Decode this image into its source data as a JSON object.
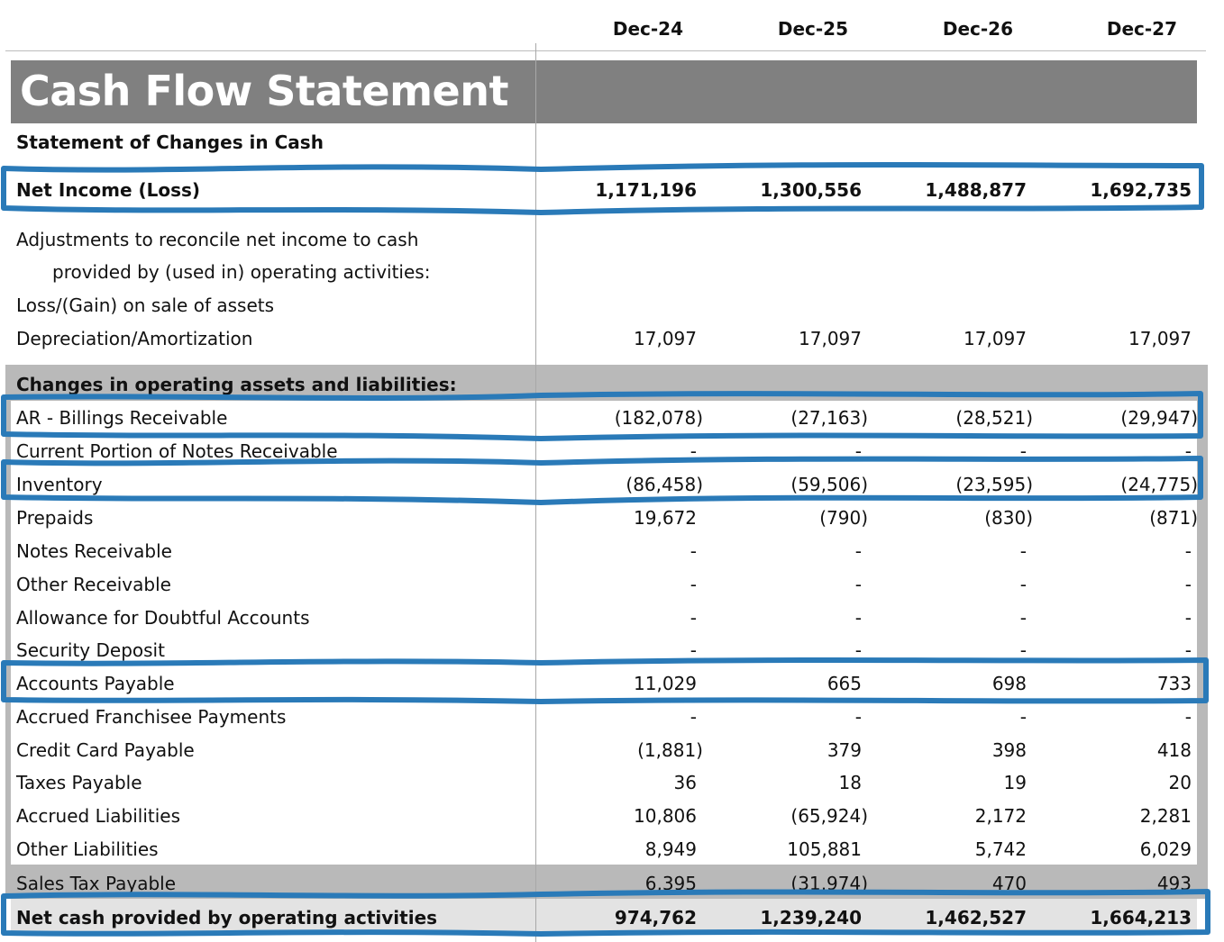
{
  "columns": [
    "Dec-24",
    "Dec-25",
    "Dec-26",
    "Dec-27"
  ],
  "title": "Cash Flow Statement",
  "subtitle": "Statement of Changes in Cash",
  "rows": [
    {
      "label": "Net Income (Loss)",
      "values": [
        "1,171,196",
        "1,300,556",
        "1,488,877",
        "1,692,735"
      ]
    },
    {
      "label": "Adjustments to reconcile net income to cash",
      "values": [
        "",
        "",
        "",
        ""
      ]
    },
    {
      "label": "provided by (used in) operating activities:",
      "values": [
        "",
        "",
        "",
        ""
      ]
    },
    {
      "label": "Loss/(Gain) on sale of assets",
      "values": [
        "",
        "",
        "",
        ""
      ]
    },
    {
      "label": "Depreciation/Amortization",
      "values": [
        "17,097",
        "17,097",
        "17,097",
        "17,097"
      ]
    },
    {
      "label": "Changes in operating assets and liabilities:",
      "values": [
        "",
        "",
        "",
        ""
      ]
    },
    {
      "label": "AR - Billings Receivable",
      "values": [
        "(182,078)",
        "(27,163)",
        "(28,521)",
        "(29,947)"
      ]
    },
    {
      "label": "Current Portion of Notes Receivable",
      "values": [
        "-",
        "-",
        "-",
        "-"
      ]
    },
    {
      "label": "Inventory",
      "values": [
        "(86,458)",
        "(59,506)",
        "(23,595)",
        "(24,775)"
      ]
    },
    {
      "label": "Prepaids",
      "values": [
        "19,672",
        "(790)",
        "(830)",
        "(871)"
      ]
    },
    {
      "label": "Notes Receivable",
      "values": [
        "-",
        "-",
        "-",
        "-"
      ]
    },
    {
      "label": "Other Receivable",
      "values": [
        "-",
        "-",
        "-",
        "-"
      ]
    },
    {
      "label": "Allowance for Doubtful Accounts",
      "values": [
        "-",
        "-",
        "-",
        "-"
      ]
    },
    {
      "label": "Security Deposit",
      "values": [
        "-",
        "-",
        "-",
        "-"
      ]
    },
    {
      "label": "Accounts Payable",
      "values": [
        "11,029",
        "665",
        "698",
        "733"
      ]
    },
    {
      "label": "Accrued Franchisee Payments",
      "values": [
        "-",
        "-",
        "-",
        "-"
      ]
    },
    {
      "label": "Credit Card Payable",
      "values": [
        "(1,881)",
        "379",
        "398",
        "418"
      ]
    },
    {
      "label": "Taxes Payable",
      "values": [
        "36",
        "18",
        "19",
        "20"
      ]
    },
    {
      "label": "Accrued Liabilities",
      "values": [
        "10,806",
        "(65,924)",
        "2,172",
        "2,281"
      ]
    },
    {
      "label": "Other Liabilities",
      "values": [
        "8,949",
        "105,881",
        "5,742",
        "6,029"
      ]
    },
    {
      "label": "Sales Tax Payable",
      "values": [
        "6,395",
        "(31,974)",
        "470",
        "493"
      ]
    },
    {
      "label": "Net cash provided by operating activities",
      "values": [
        "974,762",
        "1,239,240",
        "1,462,527",
        "1,664,213"
      ]
    }
  ],
  "colors": {
    "banner": "#808080",
    "section_band": "#b9b9b9",
    "highlight": "#2a7ab8",
    "net_band": "#e3e3e3"
  }
}
